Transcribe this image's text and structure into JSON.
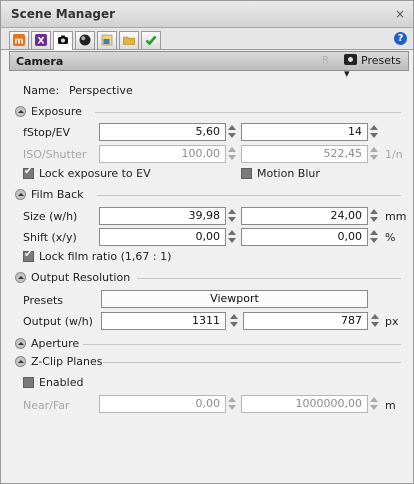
{
  "window": {
    "title": "Scene Manager",
    "close": "×"
  },
  "tabs": [
    {
      "icon": "material-m-icon",
      "color": "#e8731a"
    },
    {
      "icon": "x-tool-icon",
      "color": "#6b2f8f"
    },
    {
      "icon": "camera-tab-icon",
      "color": "#111111"
    },
    {
      "icon": "sphere-icon",
      "color": "#222222"
    },
    {
      "icon": "image-tab-icon",
      "color": "#3a7bd5"
    },
    {
      "icon": "folder-icon",
      "color": "#e3b53a"
    },
    {
      "icon": "check-icon",
      "color": "#1f9e2f"
    }
  ],
  "help": {
    "text": "?"
  },
  "header": {
    "title": "Camera",
    "r_label": "R",
    "presets_label": "Presets ▾"
  },
  "name": {
    "label": "Name:",
    "value": "Perspective"
  },
  "exposure": {
    "title": "Exposure",
    "fstop_label": "fStop/EV",
    "fstop": "5,60",
    "ev": "14",
    "iso_label": "ISO/Shutter",
    "iso": "100,00",
    "shutter": "522,45",
    "shutter_unit": "1/n",
    "lock_label": "Lock exposure to EV",
    "motion_blur_label": "Motion Blur"
  },
  "film_back": {
    "title": "Film Back",
    "size_label": "Size (w/h)",
    "size_w": "39,98",
    "size_h": "24,00",
    "size_unit": "mm",
    "shift_label": "Shift (x/y)",
    "shift_x": "0,00",
    "shift_y": "0,00",
    "shift_unit": "%",
    "lock_ratio_label": "Lock film ratio (1,67 : 1)"
  },
  "output_resolution": {
    "title": "Output Resolution",
    "presets_label": "Presets",
    "presets_value": "Viewport",
    "output_label": "Output (w/h)",
    "output_w": "1311",
    "output_h": "787",
    "output_unit": "px"
  },
  "aperture": {
    "title": "Aperture"
  },
  "zclip": {
    "title": "Z-Clip Planes",
    "enabled_label": "Enabled",
    "nearfar_label": "Near/Far",
    "near": "0,00",
    "far": "1000000,00",
    "unit": "m"
  }
}
